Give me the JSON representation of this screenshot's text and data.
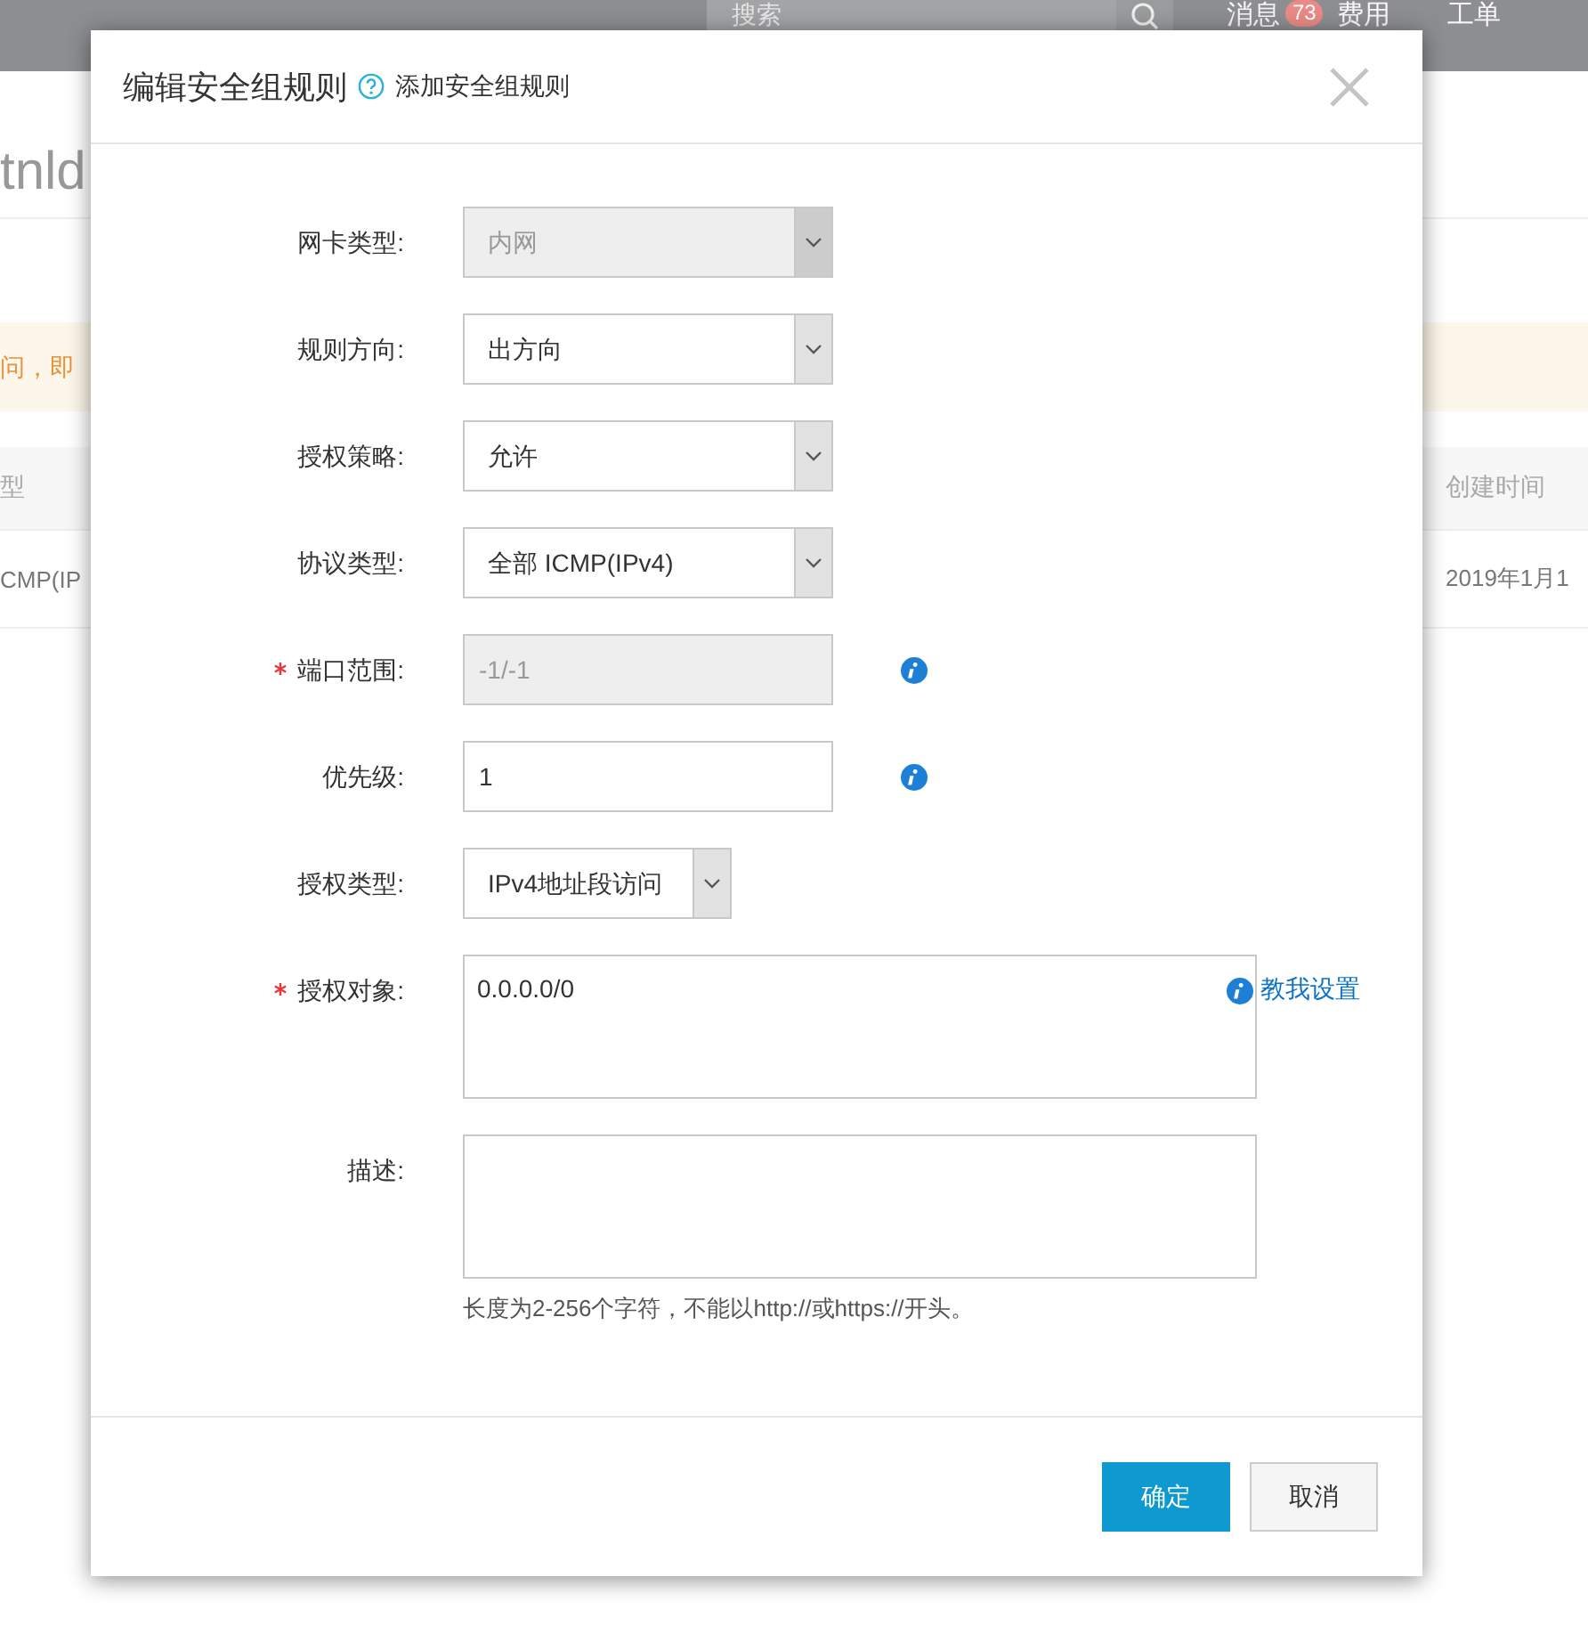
{
  "top_bar": {
    "search": {
      "placeholder": "搜索"
    },
    "items": [
      {
        "label": "消息",
        "badge": "73"
      },
      {
        "label": "费用"
      },
      {
        "label": "工单"
      }
    ]
  },
  "page": {
    "title": "tnld",
    "notice": "问，即",
    "table": {
      "columns": [
        "型",
        "创建时间"
      ],
      "rows": [
        [
          "CMP(IP",
          "2019年1月1"
        ]
      ]
    }
  },
  "dialog": {
    "title": "编辑安全组规则",
    "help_link": "添加安全组规则",
    "fields": [
      {
        "label": "网卡类型:",
        "kind": "select",
        "value": "内网",
        "disabled": true,
        "required": false,
        "info": false
      },
      {
        "label": "规则方向:",
        "kind": "select",
        "value": "出方向",
        "disabled": false,
        "required": false,
        "info": false
      },
      {
        "label": "授权策略:",
        "kind": "select",
        "value": "允许",
        "disabled": false,
        "required": false,
        "info": false
      },
      {
        "label": "协议类型:",
        "kind": "select",
        "value": "全部 ICMP(IPv4)",
        "disabled": false,
        "required": false,
        "info": false
      },
      {
        "label": "端口范围:",
        "kind": "input",
        "value": "-1/-1",
        "disabled": true,
        "required": true,
        "info": true
      },
      {
        "label": "优先级:",
        "kind": "input",
        "value": "1",
        "disabled": false,
        "required": false,
        "info": true
      },
      {
        "label": "授权类型:",
        "kind": "short-select",
        "value": "IPv4地址段访问",
        "disabled": false,
        "required": false,
        "info": false
      },
      {
        "label": "授权对象:",
        "kind": "textarea",
        "value": "0.0.0.0/0",
        "disabled": false,
        "required": true,
        "info": true,
        "link": "教我设置"
      },
      {
        "label": "描述:",
        "kind": "textarea",
        "disabled": false,
        "required": false,
        "info": false,
        "hint": "长度为2-256个字符，不能以http://或https://开头。"
      }
    ],
    "buttons": [
      {
        "label": "确定",
        "kind": "primary"
      },
      {
        "label": "取消",
        "kind": "secondary"
      }
    ]
  }
}
